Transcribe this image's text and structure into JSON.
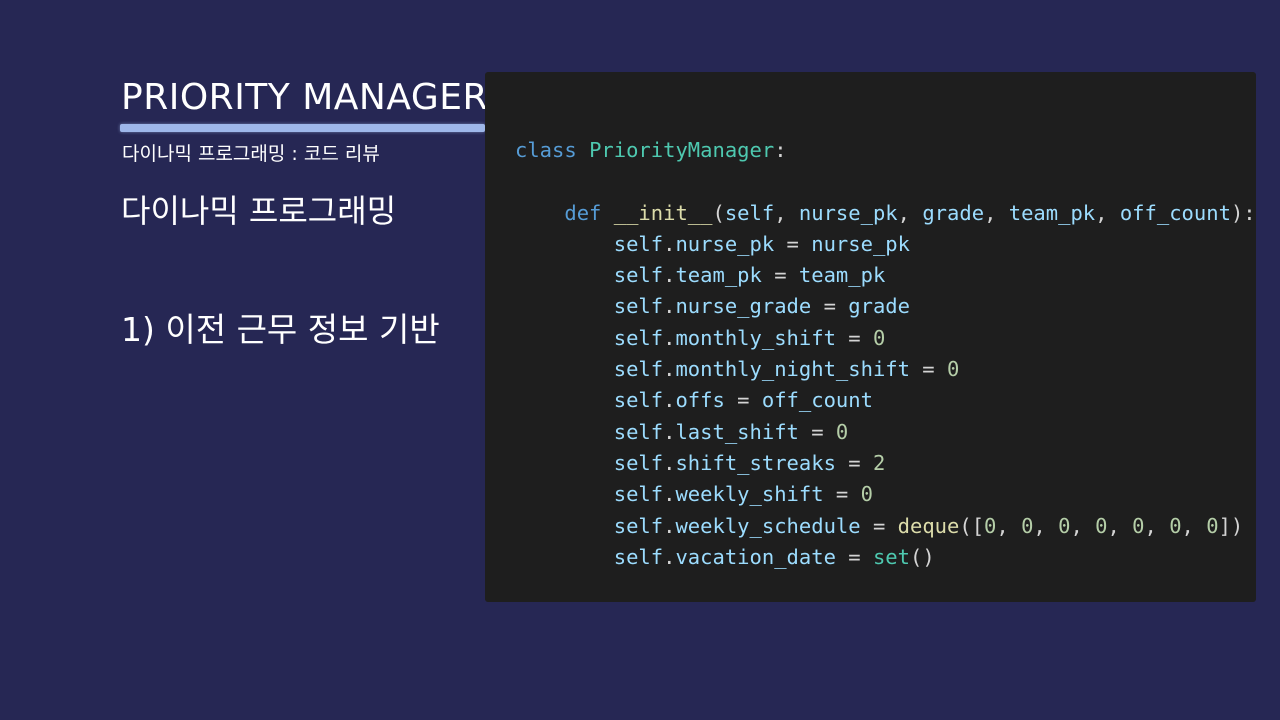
{
  "slide": {
    "title": "PRIORITY MANAGER",
    "subtitle": "다이나믹 프로그래밍 : 코드 리뷰",
    "heading": "다이나믹 프로그래밍",
    "bullet": "1) 이전 근무 정보 기반"
  },
  "code": {
    "language": "python",
    "lines": [
      [
        {
          "t": "keyword",
          "v": "class"
        },
        {
          "t": "punc",
          "v": " "
        },
        {
          "t": "class",
          "v": "PriorityManager"
        },
        {
          "t": "punc",
          "v": ":"
        }
      ],
      [],
      [
        {
          "t": "punc",
          "v": "    "
        },
        {
          "t": "keyword",
          "v": "def"
        },
        {
          "t": "punc",
          "v": " "
        },
        {
          "t": "func",
          "v": "__init__"
        },
        {
          "t": "punc",
          "v": "("
        },
        {
          "t": "var",
          "v": "self"
        },
        {
          "t": "punc",
          "v": ", "
        },
        {
          "t": "var",
          "v": "nurse_pk"
        },
        {
          "t": "punc",
          "v": ", "
        },
        {
          "t": "var",
          "v": "grade"
        },
        {
          "t": "punc",
          "v": ", "
        },
        {
          "t": "var",
          "v": "team_pk"
        },
        {
          "t": "punc",
          "v": ", "
        },
        {
          "t": "var",
          "v": "off_count"
        },
        {
          "t": "punc",
          "v": "):"
        }
      ],
      [
        {
          "t": "punc",
          "v": "        "
        },
        {
          "t": "var",
          "v": "self"
        },
        {
          "t": "punc",
          "v": "."
        },
        {
          "t": "var",
          "v": "nurse_pk"
        },
        {
          "t": "punc",
          "v": " = "
        },
        {
          "t": "var",
          "v": "nurse_pk"
        }
      ],
      [
        {
          "t": "punc",
          "v": "        "
        },
        {
          "t": "var",
          "v": "self"
        },
        {
          "t": "punc",
          "v": "."
        },
        {
          "t": "var",
          "v": "team_pk"
        },
        {
          "t": "punc",
          "v": " = "
        },
        {
          "t": "var",
          "v": "team_pk"
        }
      ],
      [
        {
          "t": "punc",
          "v": "        "
        },
        {
          "t": "var",
          "v": "self"
        },
        {
          "t": "punc",
          "v": "."
        },
        {
          "t": "var",
          "v": "nurse_grade"
        },
        {
          "t": "punc",
          "v": " = "
        },
        {
          "t": "var",
          "v": "grade"
        }
      ],
      [
        {
          "t": "punc",
          "v": "        "
        },
        {
          "t": "var",
          "v": "self"
        },
        {
          "t": "punc",
          "v": "."
        },
        {
          "t": "var",
          "v": "monthly_shift"
        },
        {
          "t": "punc",
          "v": " = "
        },
        {
          "t": "num",
          "v": "0"
        }
      ],
      [
        {
          "t": "punc",
          "v": "        "
        },
        {
          "t": "var",
          "v": "self"
        },
        {
          "t": "punc",
          "v": "."
        },
        {
          "t": "var",
          "v": "monthly_night_shift"
        },
        {
          "t": "punc",
          "v": " = "
        },
        {
          "t": "num",
          "v": "0"
        }
      ],
      [
        {
          "t": "punc",
          "v": "        "
        },
        {
          "t": "var",
          "v": "self"
        },
        {
          "t": "punc",
          "v": "."
        },
        {
          "t": "var",
          "v": "offs"
        },
        {
          "t": "punc",
          "v": " = "
        },
        {
          "t": "var",
          "v": "off_count"
        }
      ],
      [
        {
          "t": "punc",
          "v": "        "
        },
        {
          "t": "var",
          "v": "self"
        },
        {
          "t": "punc",
          "v": "."
        },
        {
          "t": "var",
          "v": "last_shift"
        },
        {
          "t": "punc",
          "v": " = "
        },
        {
          "t": "num",
          "v": "0"
        }
      ],
      [
        {
          "t": "punc",
          "v": "        "
        },
        {
          "t": "var",
          "v": "self"
        },
        {
          "t": "punc",
          "v": "."
        },
        {
          "t": "var",
          "v": "shift_streaks"
        },
        {
          "t": "punc",
          "v": " = "
        },
        {
          "t": "num",
          "v": "2"
        }
      ],
      [
        {
          "t": "punc",
          "v": "        "
        },
        {
          "t": "var",
          "v": "self"
        },
        {
          "t": "punc",
          "v": "."
        },
        {
          "t": "var",
          "v": "weekly_shift"
        },
        {
          "t": "punc",
          "v": " = "
        },
        {
          "t": "num",
          "v": "0"
        }
      ],
      [
        {
          "t": "punc",
          "v": "        "
        },
        {
          "t": "var",
          "v": "self"
        },
        {
          "t": "punc",
          "v": "."
        },
        {
          "t": "var",
          "v": "weekly_schedule"
        },
        {
          "t": "punc",
          "v": " = "
        },
        {
          "t": "func",
          "v": "deque"
        },
        {
          "t": "punc",
          "v": "(["
        },
        {
          "t": "num",
          "v": "0"
        },
        {
          "t": "punc",
          "v": ", "
        },
        {
          "t": "num",
          "v": "0"
        },
        {
          "t": "punc",
          "v": ", "
        },
        {
          "t": "num",
          "v": "0"
        },
        {
          "t": "punc",
          "v": ", "
        },
        {
          "t": "num",
          "v": "0"
        },
        {
          "t": "punc",
          "v": ", "
        },
        {
          "t": "num",
          "v": "0"
        },
        {
          "t": "punc",
          "v": ", "
        },
        {
          "t": "num",
          "v": "0"
        },
        {
          "t": "punc",
          "v": ", "
        },
        {
          "t": "num",
          "v": "0"
        },
        {
          "t": "punc",
          "v": "])"
        }
      ],
      [
        {
          "t": "punc",
          "v": "        "
        },
        {
          "t": "var",
          "v": "self"
        },
        {
          "t": "punc",
          "v": "."
        },
        {
          "t": "var",
          "v": "vacation_date"
        },
        {
          "t": "punc",
          "v": " = "
        },
        {
          "t": "class",
          "v": "set"
        },
        {
          "t": "punc",
          "v": "()"
        }
      ]
    ]
  },
  "colors": {
    "background": "#262754",
    "underline": "#9eb7ea",
    "code_background": "#1e1e1e",
    "keyword": "#569cd6",
    "class_name": "#4ec9b0",
    "function": "#dcdcaa",
    "variable": "#9cdcfe",
    "number": "#b5cea8",
    "punctuation": "#d4d4d4"
  }
}
